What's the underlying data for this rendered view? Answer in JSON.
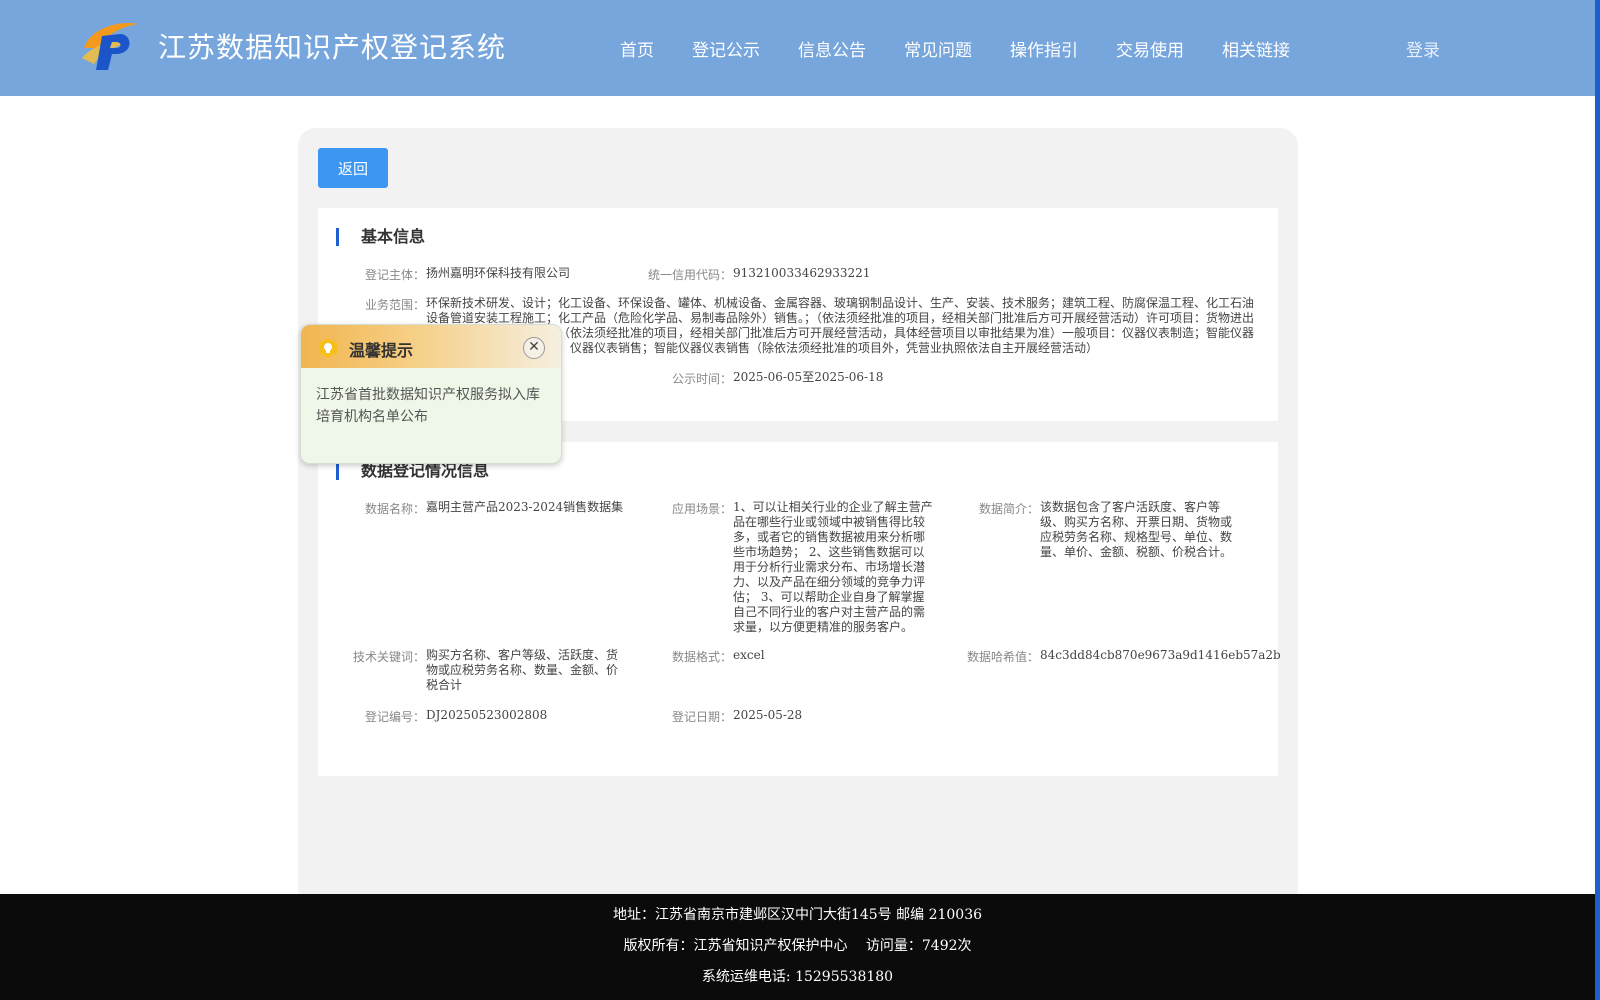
{
  "header": {
    "title": "江苏数据知识产权登记系统",
    "nav": [
      "首页",
      "登记公示",
      "信息公告",
      "常见问题",
      "操作指引",
      "交易使用",
      "相关链接"
    ],
    "login": "登录",
    "colors": {
      "header_bg": "#76a6dc",
      "accent": "#1e5fd0",
      "button": "#3c96f2"
    }
  },
  "back_label": "返回",
  "basic": {
    "title": "基本信息",
    "subject_label": "登记主体：",
    "subject": "扬州嘉明环保科技有限公司",
    "credit_label": "统一信用代码：",
    "credit": "913210033462933221",
    "scope_label": "业务范围：",
    "scope": "环保新技术研发、设计；化工设备、环保设备、罐体、机械设备、金属容器、玻璃钢制品设计、生产、安装、技术服务；建筑工程、防腐保温工程、化工石油设备管道安装工程施工；化工产品（危险化学品、易制毒品除外）销售。；（依法须经批准的项目，经相关部门批准后方可开展经营活动）许可项目：货物进出口；技术进出口；进出口（依法须经批准的项目，经相关部门批准后方可开展经营活动，具体经营项目以审批结果为准）一般项目：仪器仪表制造；智能仪器仪表制造；仪器仪表修理；仪器仪表销售；智能仪器仪表销售（除依法须经批准的项目外，凭营业执照依法自主开展经营活动）",
    "period_label": "公示时间：",
    "period": "2025-06-05至2025-06-18"
  },
  "data_reg": {
    "title": "数据登记情况信息",
    "name_label": "数据名称：",
    "name": "嘉明主营产品2023-2024销售数据集",
    "scene_label": "应用场景：",
    "scene": "1、可以让相关行业的企业了解主营产品在哪些行业或领域中被销售得比较多，或者它的销售数据被用来分析哪些市场趋势； 2、这些销售数据可以用于分析行业需求分布、市场增长潜力、以及产品在细分领域的竞争力评估； 3、可以帮助企业自身了解掌握自己不同行业的客户对主营产品的需求量，以方便更精准的服务客户。",
    "intro_label": "数据简介：",
    "intro": "该数据包含了客户活跃度、客户等级、购买方名称、开票日期、货物或应税劳务名称、规格型号、单位、数量、单价、金额、税额、价税合计。",
    "keywords_label": "技术关键词：",
    "keywords": "购买方名称、客户等级、活跃度、货物或应税劳务名称、数量、金额、价税合计",
    "format_label": "数据格式：",
    "format": "excel",
    "hash_label": "数据哈希值：",
    "hash": "84c3dd84cb870e9673a9d1416eb57a2b",
    "regno_label": "登记编号：",
    "regno": "DJ20250523002808",
    "date_label": "登记日期：",
    "date": "2025-05-28"
  },
  "popup": {
    "title": "温馨提示",
    "close": "✕",
    "message": "江苏省首批数据知识产权服务拟入库培育机构名单公布"
  },
  "footer": {
    "address": "地址：江苏省南京市建邺区汉中门大街145号 邮编 210036",
    "copyright": "版权所有：江苏省知识产权保护中心　 访问量：7492次",
    "phone": "系统运维电话: 15295538180"
  }
}
